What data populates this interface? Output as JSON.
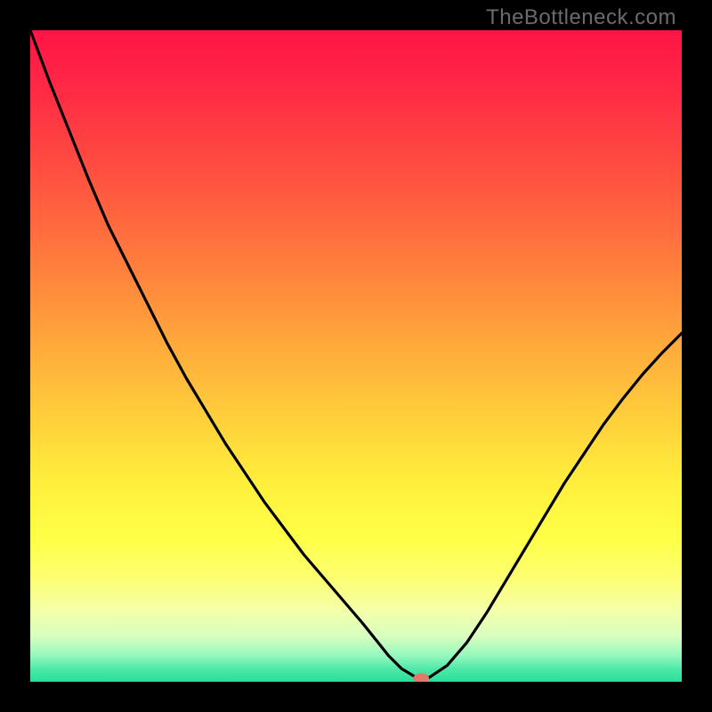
{
  "watermark": "TheBottleneck.com",
  "colors": {
    "background_black": "#000000",
    "curve_stroke": "#000000",
    "marker_fill": "#e07a6a"
  },
  "gradient_stops": [
    {
      "offset": 0.0,
      "color": "#ff1447"
    },
    {
      "offset": 0.1,
      "color": "#ff2c44"
    },
    {
      "offset": 0.2,
      "color": "#ff4a41"
    },
    {
      "offset": 0.3,
      "color": "#ff6a3e"
    },
    {
      "offset": 0.4,
      "color": "#ff8c3c"
    },
    {
      "offset": 0.5,
      "color": "#ffaf3b"
    },
    {
      "offset": 0.6,
      "color": "#ffd13b"
    },
    {
      "offset": 0.7,
      "color": "#fff03c"
    },
    {
      "offset": 0.78,
      "color": "#ffff47"
    },
    {
      "offset": 0.84,
      "color": "#fdff70"
    },
    {
      "offset": 0.89,
      "color": "#f4ffa8"
    },
    {
      "offset": 0.93,
      "color": "#d8ffc0"
    },
    {
      "offset": 0.96,
      "color": "#95f8bd"
    },
    {
      "offset": 0.98,
      "color": "#4fe9a8"
    },
    {
      "offset": 1.0,
      "color": "#25e09a"
    }
  ],
  "chart_data": {
    "type": "line",
    "title": "",
    "xlabel": "",
    "ylabel": "",
    "xlim": [
      0,
      100
    ],
    "ylim": [
      0,
      100
    ],
    "x": [
      0,
      3,
      6,
      9,
      12,
      15,
      18,
      21,
      24,
      27,
      30,
      33,
      36,
      39,
      42,
      45,
      48,
      51,
      53,
      55,
      57,
      59,
      61,
      64,
      67,
      70,
      73,
      76,
      79,
      82,
      85,
      88,
      91,
      94,
      97,
      100
    ],
    "values": [
      100,
      92,
      84.5,
      77,
      70,
      64,
      58,
      52,
      46.5,
      41.5,
      36.5,
      32,
      27.5,
      23.5,
      19.5,
      16,
      12.5,
      9.0,
      6.5,
      4.0,
      2.0,
      0.8,
      0.5,
      2.5,
      6.0,
      10.5,
      15.5,
      20.5,
      25.5,
      30.5,
      35.0,
      39.5,
      43.5,
      47.2,
      50.5,
      53.5
    ],
    "marker": {
      "x": 60,
      "y": 0.5
    },
    "notes": "x and y in percent of plot width/height; (0,0) is bottom-left. Values estimated from pixels; no axes/labels visible in source image."
  }
}
